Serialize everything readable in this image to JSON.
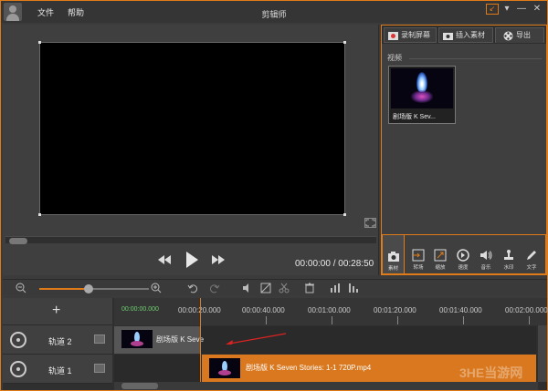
{
  "window": {
    "title": "剪辑师",
    "menu": [
      "文件",
      "帮助"
    ],
    "accent_color": "#e07b1a"
  },
  "player": {
    "time_display": "00:00:00 / 00:28:50",
    "controls": [
      "rewind-icon",
      "play-icon",
      "forward-icon",
      "fullscreen-icon"
    ]
  },
  "right_panel": {
    "tabs": [
      {
        "label": "录制屏幕",
        "icon": "record-icon"
      },
      {
        "label": "插入素材",
        "icon": "camera-icon"
      },
      {
        "label": "导出",
        "icon": "film-reel-icon"
      }
    ],
    "section_label": "视频",
    "media": [
      {
        "name": "剧场版 K Sev..."
      }
    ],
    "tools": [
      {
        "label": "素材",
        "icon": "camera-icon"
      },
      {
        "label": "转场",
        "icon": "transition-icon"
      },
      {
        "label": "缩放",
        "icon": "zoom-icon"
      },
      {
        "label": "速度",
        "icon": "speed-icon"
      },
      {
        "label": "音乐",
        "icon": "speaker-icon"
      },
      {
        "label": "水印",
        "icon": "stamp-icon"
      },
      {
        "label": "文字",
        "icon": "pen-icon"
      }
    ]
  },
  "toolbar": {
    "zoom_level": 0.45,
    "icons": [
      "zoom-out-icon",
      "zoom-in-icon",
      "undo-icon",
      "redo-icon",
      "volume-icon",
      "crop-icon",
      "cut-icon",
      "delete-icon",
      "bars-icon",
      "bars-alt-icon"
    ]
  },
  "timeline": {
    "start_time": "00:00:00.000",
    "ticks": [
      "00:00:20.000",
      "00:00:40.000",
      "00:01:00.000",
      "00:01:20.000",
      "00:01:40.000",
      "00:02:00.000"
    ],
    "add_label": "+",
    "tracks": [
      {
        "name": "轨道 2",
        "clip": "剧场版 K Seve"
      },
      {
        "name": "轨道 1",
        "clip": "剧场版 K Seven Stories: 1-1 720P.mp4"
      }
    ]
  },
  "watermark": "3HE当游网"
}
